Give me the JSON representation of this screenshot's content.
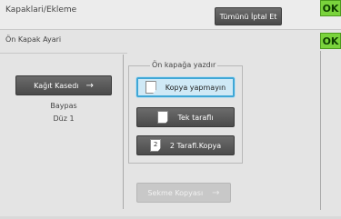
{
  "header": {
    "title": "Kapaklari/Ekleme",
    "cancel_all_label": "Tümünü İptal Et",
    "ok_label": "OK"
  },
  "panel": {
    "title": "Ön Kapak Ayari",
    "ok_label": "OK",
    "tray": {
      "button_label": "Kağıt Kasedı",
      "arrow": "→",
      "bypass_label": "Baypas",
      "paper_label": "Düz 1"
    },
    "print_group": {
      "label": "Ön kapağa yazdır",
      "options": [
        {
          "label": "Kopya yapmayın",
          "selected": true,
          "icon": "blank-page-icon"
        },
        {
          "label": "Tek taraflı",
          "selected": false,
          "icon": "single-sided-page-icon"
        },
        {
          "label": "2 Tarafl.Kopya",
          "selected": false,
          "icon": "duplex-page-icon",
          "icon_text": "2"
        }
      ]
    },
    "tab_copy": {
      "label": "Sekme Kopyası",
      "arrow": "→",
      "enabled": false
    }
  },
  "colors": {
    "ok_green": "#7ad33c",
    "selected_bg": "#cfe9f6",
    "selected_border": "#3fa7d6",
    "button_dark": "#555555"
  }
}
